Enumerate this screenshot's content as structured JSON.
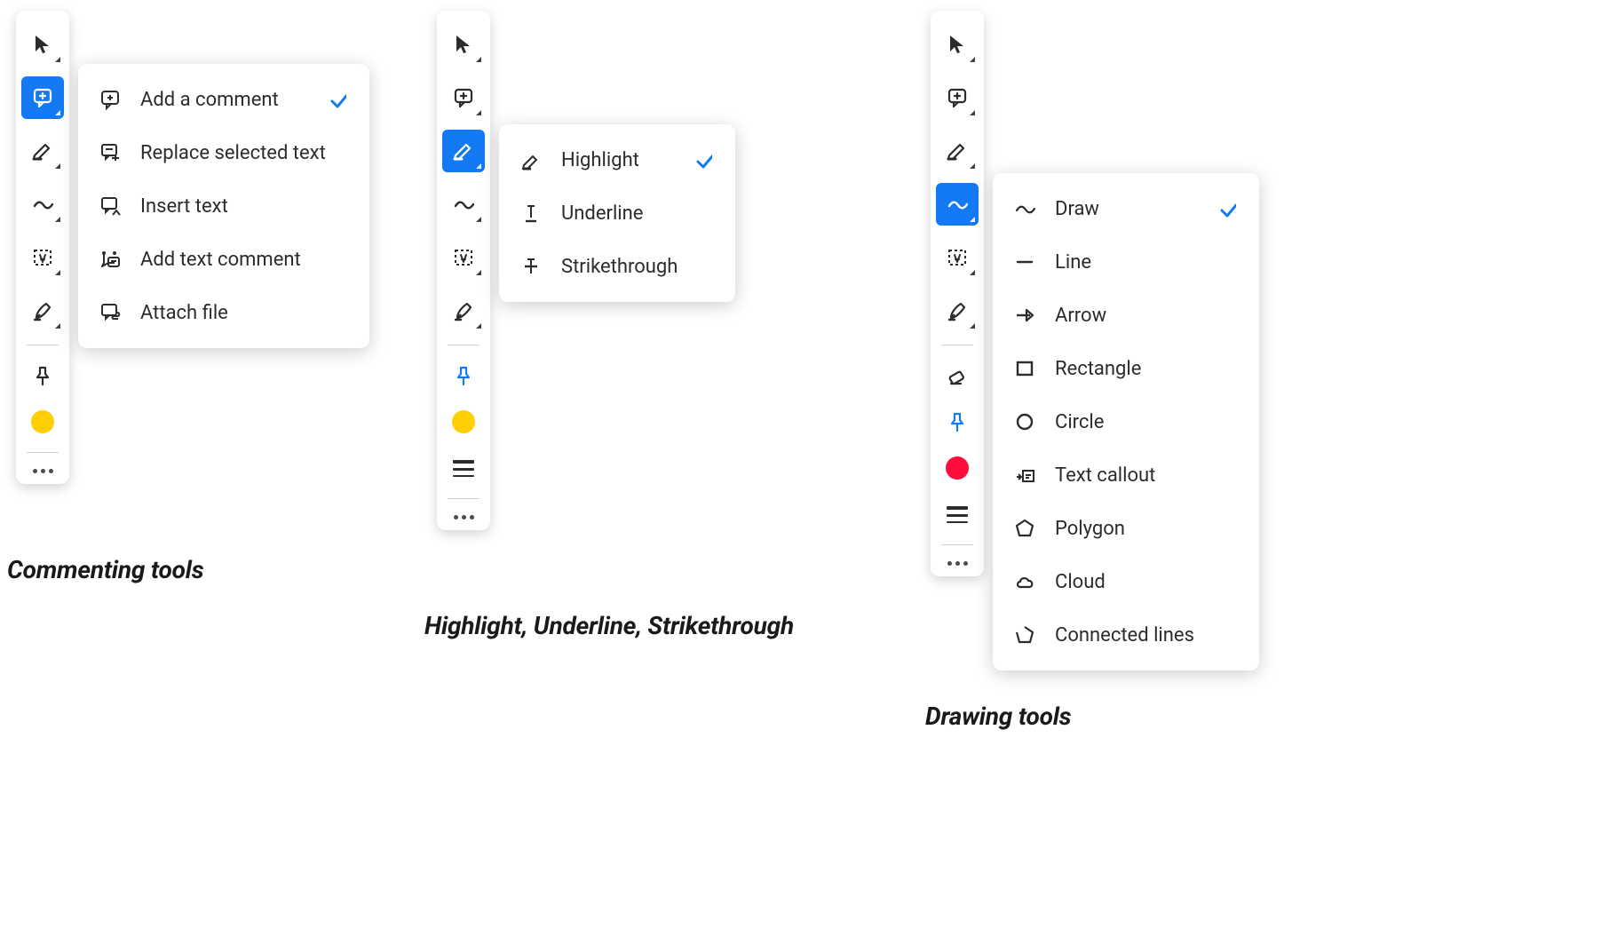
{
  "colors": {
    "accent": "#147af3",
    "yellow": "#ffcf02",
    "red": "#ff0d3a"
  },
  "panels": {
    "commenting": {
      "caption": "Commenting tools",
      "toolbar_color": "#ffcf02",
      "selected_tool": "comment",
      "flyout": [
        {
          "icon": "comment-plus",
          "label": "Add a comment",
          "checked": true
        },
        {
          "icon": "replace-text",
          "label": "Replace selected text",
          "checked": false
        },
        {
          "icon": "insert-text",
          "label": "Insert text",
          "checked": false
        },
        {
          "icon": "text-comment",
          "label": "Add text comment",
          "checked": false
        },
        {
          "icon": "attach-file",
          "label": "Attach file",
          "checked": false
        }
      ]
    },
    "highlight": {
      "caption": "Highlight, Underline, Strikethrough",
      "toolbar_color": "#ffcf02",
      "selected_tool": "highlight",
      "flyout": [
        {
          "icon": "highlight",
          "label": "Highlight",
          "checked": true
        },
        {
          "icon": "underline",
          "label": "Underline",
          "checked": false
        },
        {
          "icon": "strikethrough",
          "label": "Strikethrough",
          "checked": false
        }
      ]
    },
    "drawing": {
      "caption": "Drawing tools",
      "toolbar_color": "#ff0d3a",
      "selected_tool": "draw",
      "flyout": [
        {
          "icon": "draw-free",
          "label": "Draw",
          "checked": true
        },
        {
          "icon": "line",
          "label": "Line",
          "checked": false
        },
        {
          "icon": "arrow",
          "label": "Arrow",
          "checked": false
        },
        {
          "icon": "rectangle",
          "label": "Rectangle",
          "checked": false
        },
        {
          "icon": "circle",
          "label": "Circle",
          "checked": false
        },
        {
          "icon": "text-callout",
          "label": "Text callout",
          "checked": false
        },
        {
          "icon": "polygon",
          "label": "Polygon",
          "checked": false
        },
        {
          "icon": "cloud",
          "label": "Cloud",
          "checked": false
        },
        {
          "icon": "connected-lines",
          "label": "Connected lines",
          "checked": false
        }
      ]
    }
  }
}
